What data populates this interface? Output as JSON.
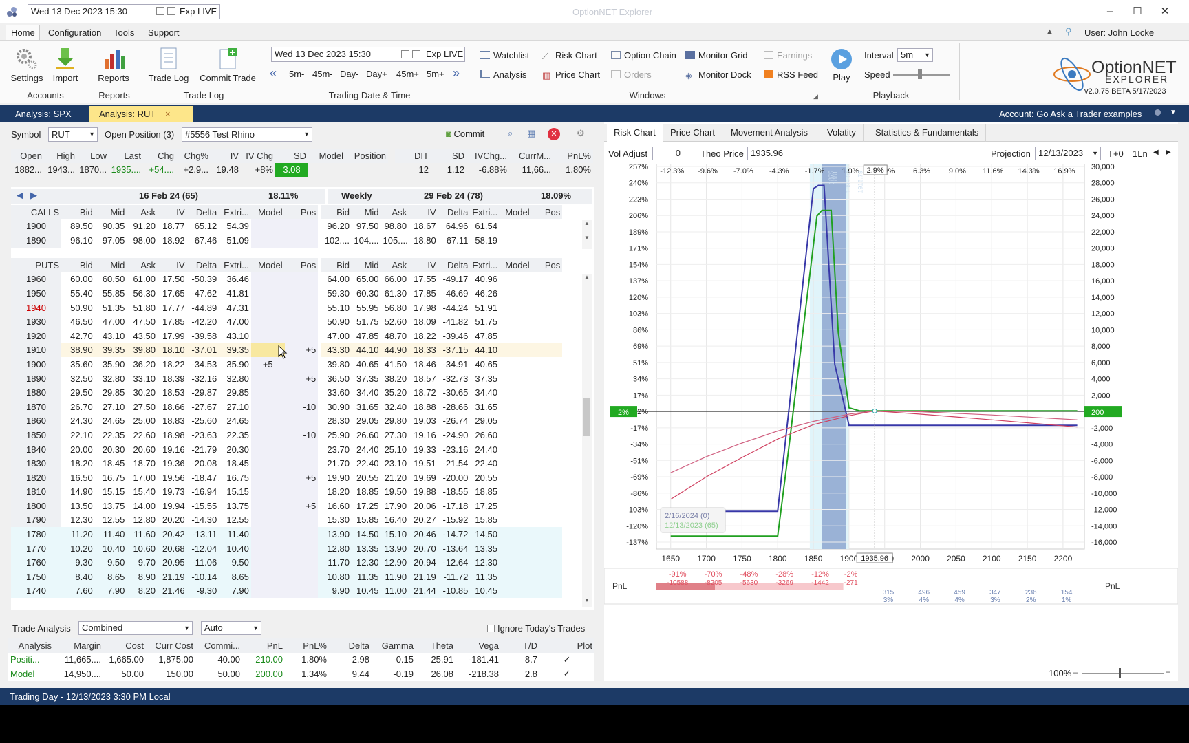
{
  "titlebar": {
    "datetime": "Wed 13 Dec 2023 15:30",
    "exp_live": "Exp LIVE",
    "app_title": "OptionNET Explorer",
    "user": "User: John Locke"
  },
  "menu": [
    "Home",
    "Configuration",
    "Tools",
    "Support"
  ],
  "ribbon": {
    "settings": "Settings",
    "import": "Import",
    "reports": "Reports",
    "trade_log": "Trade Log",
    "commit_trade": "Commit Trade",
    "groups": {
      "accounts": "Accounts",
      "reports": "Reports",
      "trade_log": "Trade Log",
      "trading_date": "Trading Date & Time",
      "windows": "Windows",
      "playback": "Playback"
    },
    "date_value": "Wed 13 Dec 2023 15:30",
    "date_exp": "Exp LIVE",
    "steps": [
      "5m-",
      "45m-",
      "Day-",
      "Day+",
      "45m+",
      "5m+"
    ],
    "windows": {
      "watchlist": "Watchlist",
      "risk_chart": "Risk Chart",
      "option_chain": "Option Chain",
      "monitor_grid": "Monitor Grid",
      "earnings": "Earnings",
      "analysis": "Analysis",
      "price_chart": "Price Chart",
      "orders": "Orders",
      "monitor_dock": "Monitor Dock",
      "rss_feed": "RSS Feed"
    },
    "play": "Play",
    "interval_label": "Interval",
    "interval_value": "5m",
    "speed_label": "Speed",
    "logo_top": "OptionNET",
    "logo_bottom": "EXPLORER",
    "version": "v2.0.75 BETA 5/17/2023"
  },
  "tabs": {
    "spx": "Analysis: SPX",
    "rut": "Analysis: RUT",
    "close": "×",
    "account": "Account: Go Ask a Trader examples"
  },
  "toolbar": {
    "symbol_label": "Symbol",
    "symbol": "RUT",
    "open_position_label": "Open Position (3)",
    "position": "#5556 Test  Rhino",
    "commit": "Commit"
  },
  "quote": {
    "headers": [
      "Open",
      "High",
      "Low",
      "Last",
      "Chg",
      "Chg%",
      "IV",
      "IV Chg",
      "SD",
      "Model",
      "Position"
    ],
    "values": [
      "1882...",
      "1943...",
      "1870...",
      "1935....",
      "+54....",
      "+2.9...",
      "19.48",
      "+8%",
      "3.08",
      "",
      ""
    ],
    "headers2": [
      "DIT",
      "SD",
      "IVChg...",
      "CurrM...",
      "PnL%"
    ],
    "values2": [
      "12",
      "1.12",
      "-6.88%",
      "11,66...",
      "1.80%"
    ]
  },
  "exp1": {
    "title": "16 Feb 24 (65)",
    "iv": "18.11%"
  },
  "exp2": {
    "weekly": "Weekly",
    "title": "29 Feb 24 (78)",
    "iv": "18.09%"
  },
  "calls_headers": [
    "CALLS",
    "Bid",
    "Mid",
    "Ask",
    "IV",
    "Delta",
    "Extri...",
    "Model",
    "Pos"
  ],
  "chain_headers2": [
    "Bid",
    "Mid",
    "Ask",
    "IV",
    "Delta",
    "Extri...",
    "Model",
    "Pos"
  ],
  "calls": [
    {
      "strike": "1900",
      "l": [
        "89.50",
        "90.35",
        "91.20",
        "18.77",
        "65.12",
        "54.39",
        "",
        ""
      ],
      "r": [
        "96.20",
        "97.50",
        "98.80",
        "18.67",
        "64.96",
        "61.54",
        "",
        ""
      ]
    },
    {
      "strike": "1890",
      "l": [
        "96.10",
        "97.05",
        "98.00",
        "18.92",
        "67.46",
        "51.09",
        "",
        ""
      ],
      "r": [
        "102....",
        "104....",
        "105....",
        "18.80",
        "67.11",
        "58.19",
        "",
        ""
      ]
    }
  ],
  "puts_header": "PUTS",
  "puts": [
    {
      "strike": "1960",
      "l": [
        "60.00",
        "60.50",
        "61.00",
        "17.50",
        "-50.39",
        "36.46",
        "",
        ""
      ],
      "r": [
        "64.00",
        "65.00",
        "66.00",
        "17.55",
        "-49.17",
        "40.96",
        "",
        ""
      ]
    },
    {
      "strike": "1950",
      "l": [
        "55.40",
        "55.85",
        "56.30",
        "17.65",
        "-47.62",
        "41.81",
        "",
        ""
      ],
      "r": [
        "59.30",
        "60.30",
        "61.30",
        "17.85",
        "-46.69",
        "46.26",
        "",
        ""
      ]
    },
    {
      "strike": "1940",
      "l": [
        "50.90",
        "51.35",
        "51.80",
        "17.77",
        "-44.89",
        "47.31",
        "",
        ""
      ],
      "r": [
        "55.10",
        "55.95",
        "56.80",
        "17.98",
        "-44.24",
        "51.91",
        "",
        ""
      ]
    },
    {
      "strike": "1930",
      "l": [
        "46.50",
        "47.00",
        "47.50",
        "17.85",
        "-42.20",
        "47.00",
        "",
        ""
      ],
      "r": [
        "50.90",
        "51.75",
        "52.60",
        "18.09",
        "-41.82",
        "51.75",
        "",
        ""
      ]
    },
    {
      "strike": "1920",
      "l": [
        "42.70",
        "43.10",
        "43.50",
        "17.99",
        "-39.58",
        "43.10",
        "",
        ""
      ],
      "r": [
        "47.00",
        "47.85",
        "48.70",
        "18.22",
        "-39.46",
        "47.85",
        "",
        ""
      ]
    },
    {
      "strike": "1910",
      "l": [
        "38.90",
        "39.35",
        "39.80",
        "18.10",
        "-37.01",
        "39.35",
        "",
        "+5"
      ],
      "r": [
        "43.30",
        "44.10",
        "44.90",
        "18.33",
        "-37.15",
        "44.10",
        "",
        ""
      ]
    },
    {
      "strike": "1900",
      "l": [
        "35.60",
        "35.90",
        "36.20",
        "18.22",
        "-34.53",
        "35.90",
        "+5",
        ""
      ],
      "r": [
        "39.80",
        "40.65",
        "41.50",
        "18.46",
        "-34.91",
        "40.65",
        "",
        ""
      ]
    },
    {
      "strike": "1890",
      "l": [
        "32.50",
        "32.80",
        "33.10",
        "18.39",
        "-32.16",
        "32.80",
        "",
        "+5"
      ],
      "r": [
        "36.50",
        "37.35",
        "38.20",
        "18.57",
        "-32.73",
        "37.35",
        "",
        ""
      ]
    },
    {
      "strike": "1880",
      "l": [
        "29.50",
        "29.85",
        "30.20",
        "18.53",
        "-29.87",
        "29.85",
        "",
        ""
      ],
      "r": [
        "33.60",
        "34.40",
        "35.20",
        "18.72",
        "-30.65",
        "34.40",
        "",
        ""
      ]
    },
    {
      "strike": "1870",
      "l": [
        "26.70",
        "27.10",
        "27.50",
        "18.66",
        "-27.67",
        "27.10",
        "",
        "-10"
      ],
      "r": [
        "30.90",
        "31.65",
        "32.40",
        "18.88",
        "-28.66",
        "31.65",
        "",
        ""
      ]
    },
    {
      "strike": "1860",
      "l": [
        "24.30",
        "24.65",
        "25.00",
        "18.83",
        "-25.60",
        "24.65",
        "",
        ""
      ],
      "r": [
        "28.30",
        "29.05",
        "29.80",
        "19.03",
        "-26.74",
        "29.05",
        "",
        ""
      ]
    },
    {
      "strike": "1850",
      "l": [
        "22.10",
        "22.35",
        "22.60",
        "18.98",
        "-23.63",
        "22.35",
        "",
        "-10"
      ],
      "r": [
        "25.90",
        "26.60",
        "27.30",
        "19.16",
        "-24.90",
        "26.60",
        "",
        ""
      ]
    },
    {
      "strike": "1840",
      "l": [
        "20.00",
        "20.30",
        "20.60",
        "19.16",
        "-21.79",
        "20.30",
        "",
        ""
      ],
      "r": [
        "23.70",
        "24.40",
        "25.10",
        "19.33",
        "-23.16",
        "24.40",
        "",
        ""
      ]
    },
    {
      "strike": "1830",
      "l": [
        "18.20",
        "18.45",
        "18.70",
        "19.36",
        "-20.08",
        "18.45",
        "",
        ""
      ],
      "r": [
        "21.70",
        "22.40",
        "23.10",
        "19.51",
        "-21.54",
        "22.40",
        "",
        ""
      ]
    },
    {
      "strike": "1820",
      "l": [
        "16.50",
        "16.75",
        "17.00",
        "19.56",
        "-18.47",
        "16.75",
        "",
        "+5"
      ],
      "r": [
        "19.90",
        "20.55",
        "21.20",
        "19.69",
        "-20.00",
        "20.55",
        "",
        ""
      ]
    },
    {
      "strike": "1810",
      "l": [
        "14.90",
        "15.15",
        "15.40",
        "19.73",
        "-16.94",
        "15.15",
        "",
        ""
      ],
      "r": [
        "18.20",
        "18.85",
        "19.50",
        "19.88",
        "-18.55",
        "18.85",
        "",
        ""
      ]
    },
    {
      "strike": "1800",
      "l": [
        "13.50",
        "13.75",
        "14.00",
        "19.94",
        "-15.55",
        "13.75",
        "",
        "+5"
      ],
      "r": [
        "16.60",
        "17.25",
        "17.90",
        "20.06",
        "-17.18",
        "17.25",
        "",
        ""
      ]
    },
    {
      "strike": "1790",
      "l": [
        "12.30",
        "12.55",
        "12.80",
        "20.20",
        "-14.30",
        "12.55",
        "",
        ""
      ],
      "r": [
        "15.30",
        "15.85",
        "16.40",
        "20.27",
        "-15.92",
        "15.85",
        "",
        ""
      ]
    },
    {
      "strike": "1780",
      "l": [
        "11.20",
        "11.40",
        "11.60",
        "20.42",
        "-13.11",
        "11.40",
        "",
        ""
      ],
      "r": [
        "13.90",
        "14.50",
        "15.10",
        "20.46",
        "-14.72",
        "14.50",
        "",
        ""
      ]
    },
    {
      "strike": "1770",
      "l": [
        "10.20",
        "10.40",
        "10.60",
        "20.68",
        "-12.04",
        "10.40",
        "",
        ""
      ],
      "r": [
        "12.80",
        "13.35",
        "13.90",
        "20.70",
        "-13.64",
        "13.35",
        "",
        ""
      ]
    },
    {
      "strike": "1760",
      "l": [
        "9.30",
        "9.50",
        "9.70",
        "20.95",
        "-11.06",
        "9.50",
        "",
        ""
      ],
      "r": [
        "11.70",
        "12.30",
        "12.90",
        "20.94",
        "-12.64",
        "12.30",
        "",
        ""
      ]
    },
    {
      "strike": "1750",
      "l": [
        "8.40",
        "8.65",
        "8.90",
        "21.19",
        "-10.14",
        "8.65",
        "",
        ""
      ],
      "r": [
        "10.80",
        "11.35",
        "11.90",
        "21.19",
        "-11.72",
        "11.35",
        "",
        ""
      ]
    },
    {
      "strike": "1740",
      "l": [
        "7.60",
        "7.90",
        "8.20",
        "21.46",
        "-9.30",
        "7.90",
        "",
        ""
      ],
      "r": [
        "9.90",
        "10.45",
        "11.00",
        "21.44",
        "-10.85",
        "10.45",
        "",
        ""
      ]
    }
  ],
  "trade_analysis": {
    "label": "Trade Analysis",
    "mode": "Combined",
    "auto": "Auto",
    "ignore": "Ignore Today's Trades",
    "headers": [
      "Analysis",
      "Margin",
      "Cost",
      "Curr Cost",
      "Commi...",
      "PnL",
      "PnL%",
      "Delta",
      "Gamma",
      "Theta",
      "Vega",
      "T/D",
      "Plot"
    ],
    "rows": [
      [
        "Positi...",
        "11,665....",
        "-1,665.00",
        "1,875.00",
        "40.00",
        "210.00",
        "1.80%",
        "-2.98",
        "-0.15",
        "25.91",
        "-181.41",
        "8.7",
        "✓"
      ],
      [
        "Model",
        "14,950....",
        "50.00",
        "150.00",
        "50.00",
        "200.00",
        "1.34%",
        "9.44",
        "-0.19",
        "26.08",
        "-218.38",
        "2.8",
        "✓"
      ]
    ]
  },
  "chart_tabs": [
    "Risk Chart",
    "Price Chart",
    "Movement Analysis",
    "Volatity",
    "Statistics & Fundamentals"
  ],
  "chart_toolbar": {
    "vol_adjust": "Vol Adjust",
    "vol_value": "0",
    "theo_label": "Theo Price",
    "theo_value": "1935.96",
    "projection": "Projection",
    "proj_date": "12/13/2023",
    "t0": "T+0",
    "ln": "1Ln"
  },
  "chart_data": {
    "type": "line",
    "x_ticks": [
      "1650",
      "1700",
      "1750",
      "1800",
      "1850",
      "1900",
      "1950",
      "2000",
      "2050",
      "2100",
      "2150",
      "2200"
    ],
    "top_pct_ticks": [
      "-12.3%",
      "-9.6%",
      "-7.0%",
      "-4.3%",
      "-1.7%",
      "1.0%",
      "2.9%",
      "6.3%",
      "9.0%",
      "11.6%",
      "14.3%",
      "16.9%"
    ],
    "left_pct_ticks": [
      "257%",
      "240%",
      "223%",
      "206%",
      "189%",
      "171%",
      "154%",
      "137%",
      "120%",
      "103%",
      "86%",
      "69%",
      "51%",
      "34%",
      "17%",
      "2%",
      "-17%",
      "-34%",
      "-51%",
      "-69%",
      "-86%",
      "-103%",
      "-120%",
      "-137%"
    ],
    "right_ticks": [
      "30,000",
      "28,000",
      "26,000",
      "24,000",
      "22,000",
      "20,000",
      "18,000",
      "16,000",
      "14,000",
      "12,000",
      "10,000",
      "8,000",
      "6,000",
      "4,000",
      "2,000",
      "200",
      "-2,000",
      "-4,000",
      "-6,000",
      "-8,000",
      "-10,000",
      "-12,000",
      "-14,000",
      "-16,000"
    ],
    "current_price": "1935.96",
    "current_pct": "2.9%",
    "zero_left": "2%",
    "zero_right": "200",
    "vline_labels": [
      "1875",
      "1881",
      "1899.03",
      "1916.79"
    ],
    "legend": [
      "2/16/2024 (0)",
      "12/13/2023 (65)"
    ],
    "xlim": [
      1630,
      2230
    ],
    "ylim": [
      -17000,
      31000
    ],
    "series": [
      {
        "name": "2/16/2024 (0)",
        "color": "#3838a8",
        "x": [
          1650,
          1800,
          1850,
          1857,
          1865,
          1880,
          1900,
          1912,
          2220
        ],
        "y": [
          -12300,
          -12300,
          27900,
          28300,
          28300,
          6000,
          -1600,
          -1600,
          -1600
        ]
      },
      {
        "name": "12/13/2023 (65)",
        "color": "#20a020",
        "x": [
          1650,
          1800,
          1812,
          1855,
          1862,
          1875,
          1885,
          1900,
          1915,
          1950,
          2050,
          2220
        ],
        "y": [
          -15400,
          -15400,
          -7000,
          24500,
          25200,
          25200,
          10000,
          600,
          200,
          200,
          200,
          200
        ]
      },
      {
        "name": "",
        "color": "#d04060",
        "x": [
          1650,
          1700,
          1750,
          1800,
          1850,
          1900,
          1935,
          2000,
          2100,
          2220
        ],
        "y": [
          -10800,
          -8000,
          -5600,
          -3300,
          -1500,
          -400,
          200,
          -200,
          -900,
          -1800
        ]
      },
      {
        "name": "",
        "color": "#d06080",
        "x": [
          1650,
          1700,
          1750,
          1800,
          1850,
          1900,
          1935,
          2000,
          2100,
          2220
        ],
        "y": [
          -7500,
          -5500,
          -3800,
          -2300,
          -1100,
          -200,
          200,
          100,
          -300,
          -900
        ]
      }
    ]
  },
  "pnl_strip": {
    "label": "PnL",
    "neg_pct": [
      "-91%",
      "-70%",
      "-48%",
      "-28%",
      "-12%",
      "-2%"
    ],
    "neg_val": [
      "-10588",
      "-8205",
      "-5630",
      "-3269",
      "-1442",
      "-271"
    ],
    "pos_val": [
      "315",
      "496",
      "459",
      "347",
      "236",
      "154"
    ],
    "pos_pct": [
      "3%",
      "4%",
      "4%",
      "3%",
      "2%",
      "1%"
    ]
  },
  "zoom": "100%",
  "status": "Trading Day - 12/13/2023 3:30 PM Local"
}
